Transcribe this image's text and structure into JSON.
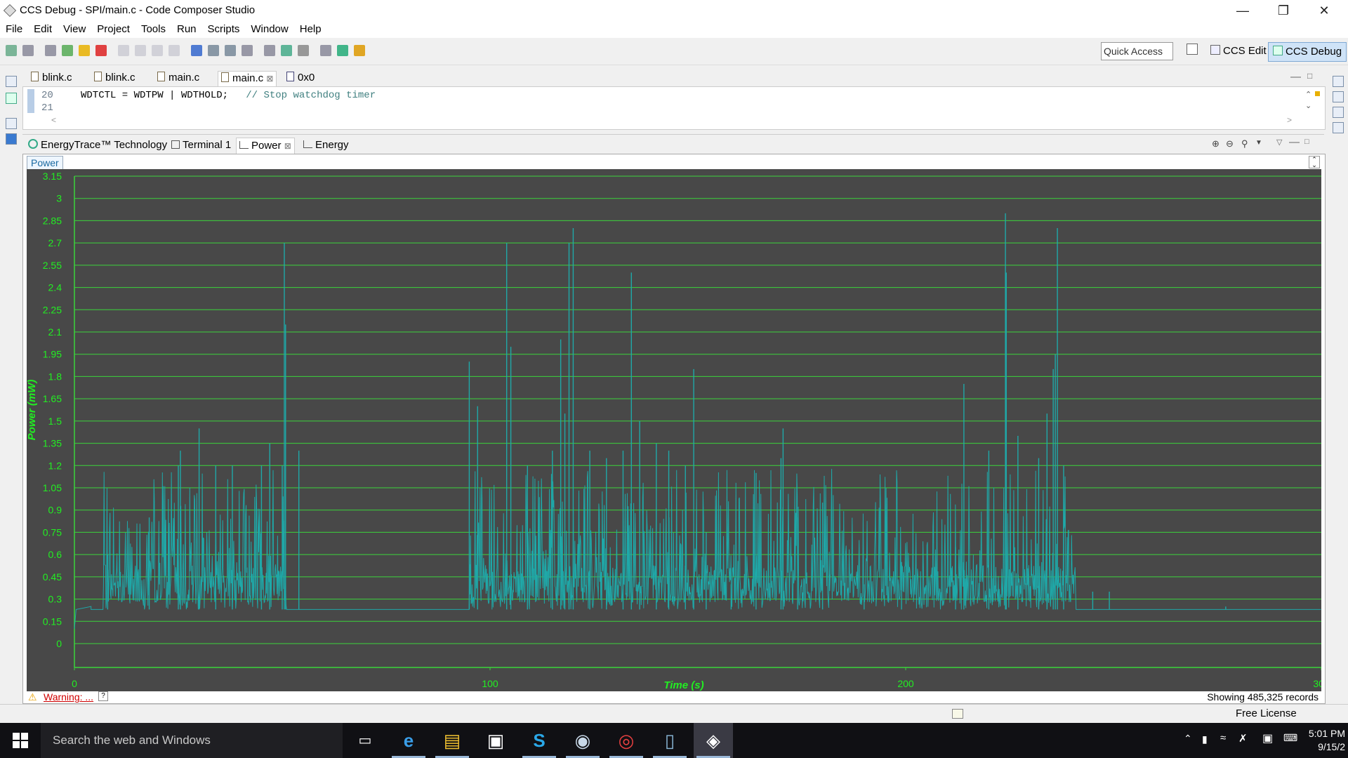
{
  "window": {
    "title": "CCS Debug - SPI/main.c - Code Composer Studio"
  },
  "menu": [
    "File",
    "Edit",
    "View",
    "Project",
    "Tools",
    "Run",
    "Scripts",
    "Window",
    "Help"
  ],
  "toolbar": {
    "quick_access": "Quick Access",
    "perspectives": [
      "CCS Edit",
      "CCS Debug"
    ],
    "active_perspective": "CCS Debug"
  },
  "editor": {
    "tabs": [
      {
        "label": "blink.c"
      },
      {
        "label": "blink.c"
      },
      {
        "label": "main.c"
      },
      {
        "label": "main.c",
        "active": true,
        "close": "⊠"
      },
      {
        "label": "0x0"
      }
    ],
    "lines": [
      {
        "no": "20",
        "code": "WDTCTL = WDTPW | WDTHOLD;",
        "comment": "// Stop watchdog timer"
      },
      {
        "no": "21",
        "code": "",
        "comment": ""
      }
    ]
  },
  "views": {
    "tabs": [
      {
        "label": "EnergyTrace™ Technology"
      },
      {
        "label": "Terminal 1"
      },
      {
        "label": "Power",
        "active": true,
        "close": "⊠"
      },
      {
        "label": "Energy"
      }
    ],
    "inner_tab": "Power",
    "warning": "Warning: ...",
    "records": "Showing 485,325 records"
  },
  "status": {
    "license": "Free License"
  },
  "taskbar": {
    "search": "Search the web and Windows",
    "apps": [
      "task-view",
      "edge",
      "file-explorer",
      "store",
      "skype",
      "steam",
      "chrome",
      "app-7",
      "app-8"
    ],
    "clock_time": "5:01 PM",
    "clock_date": "9/15/2"
  },
  "colors": {
    "chart_bg": "#484848",
    "grid": "#3bd43b",
    "trace": "#1fa8a8",
    "axis_text": "#22ee22"
  },
  "chart_data": {
    "type": "line",
    "xlabel": "Time  (s)",
    "ylabel": "Power  (mW)",
    "xlim": [
      0,
      300
    ],
    "ylim": [
      0,
      3.15
    ],
    "xticks": [
      0,
      100,
      200,
      300
    ],
    "yticks": [
      0,
      0.15,
      0.3,
      0.45,
      0.6,
      0.75,
      0.9,
      1.05,
      1.2,
      1.35,
      1.5,
      1.65,
      1.8,
      1.95,
      2.1,
      2.25,
      2.4,
      2.55,
      2.7,
      2.85,
      3,
      3.15
    ],
    "grid": true,
    "baseline": 0.23,
    "peaks": [
      {
        "x": 8,
        "y": 0.6
      },
      {
        "x": 18,
        "y": 0.85
      },
      {
        "x": 25,
        "y": 1.2
      },
      {
        "x": 25.5,
        "y": 1.3
      },
      {
        "x": 30,
        "y": 1.45
      },
      {
        "x": 34,
        "y": 1.2
      },
      {
        "x": 38,
        "y": 1.2
      },
      {
        "x": 45,
        "y": 1.2
      },
      {
        "x": 47,
        "y": 1.35
      },
      {
        "x": 50,
        "y": 1.2
      },
      {
        "x": 54,
        "y": 1.3
      },
      {
        "x": 50.5,
        "y": 2.7
      },
      {
        "x": 50.8,
        "y": 2.15
      },
      {
        "x": 95,
        "y": 1.9
      },
      {
        "x": 97,
        "y": 1.6
      },
      {
        "x": 104,
        "y": 2.7
      },
      {
        "x": 105,
        "y": 2.0
      },
      {
        "x": 109,
        "y": 1.2
      },
      {
        "x": 115,
        "y": 1.3
      },
      {
        "x": 117,
        "y": 2.05
      },
      {
        "x": 118,
        "y": 1.55
      },
      {
        "x": 119,
        "y": 2.7
      },
      {
        "x": 120,
        "y": 2.8
      },
      {
        "x": 124,
        "y": 1.3
      },
      {
        "x": 128,
        "y": 1.25
      },
      {
        "x": 132,
        "y": 1.3
      },
      {
        "x": 134,
        "y": 2.5
      },
      {
        "x": 136,
        "y": 1.5
      },
      {
        "x": 140,
        "y": 1.35
      },
      {
        "x": 143,
        "y": 1.3
      },
      {
        "x": 147,
        "y": 1.2
      },
      {
        "x": 149,
        "y": 1.85
      },
      {
        "x": 152,
        "y": 0.75
      },
      {
        "x": 158,
        "y": 0.4
      },
      {
        "x": 164,
        "y": 1.15
      },
      {
        "x": 170,
        "y": 1.25
      },
      {
        "x": 170.5,
        "y": 1.45
      },
      {
        "x": 174,
        "y": 0.85
      },
      {
        "x": 180,
        "y": 0.95
      },
      {
        "x": 190,
        "y": 0.4
      },
      {
        "x": 199,
        "y": 0.55
      },
      {
        "x": 212,
        "y": 0.65
      },
      {
        "x": 214,
        "y": 1.75
      },
      {
        "x": 220,
        "y": 1.3
      },
      {
        "x": 224,
        "y": 2.9
      },
      {
        "x": 224.2,
        "y": 2.5
      },
      {
        "x": 227,
        "y": 1.4
      },
      {
        "x": 232,
        "y": 1.25
      },
      {
        "x": 234,
        "y": 1.55
      },
      {
        "x": 236,
        "y": 1.95
      },
      {
        "x": 235.5,
        "y": 1.85
      },
      {
        "x": 236.5,
        "y": 2.8
      },
      {
        "x": 238,
        "y": 1.2
      },
      {
        "x": 245,
        "y": 0.35
      },
      {
        "x": 249,
        "y": 0.35
      },
      {
        "x": 277,
        "y": 0.25
      }
    ]
  }
}
